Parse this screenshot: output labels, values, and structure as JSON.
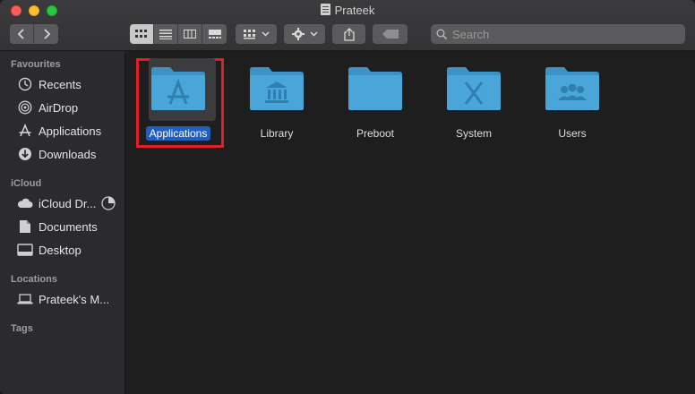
{
  "window": {
    "title": "Prateek"
  },
  "toolbar": {
    "back_icon": "chevron-left-icon",
    "forward_icon": "chevron-right-icon",
    "view_modes": [
      "icon-view",
      "list-view",
      "column-view",
      "gallery-view"
    ],
    "active_view": "icon-view",
    "search_placeholder": "Search"
  },
  "sidebar": {
    "favourites_header": "Favourites",
    "favourites": [
      {
        "label": "Recents",
        "icon": "clock-icon"
      },
      {
        "label": "AirDrop",
        "icon": "airdrop-icon"
      },
      {
        "label": "Applications",
        "icon": "applications-icon"
      },
      {
        "label": "Downloads",
        "icon": "download-icon"
      }
    ],
    "icloud_header": "iCloud",
    "icloud": [
      {
        "label": "iCloud Dr...",
        "icon": "cloud-icon"
      },
      {
        "label": "Documents",
        "icon": "document-icon"
      },
      {
        "label": "Desktop",
        "icon": "desktop-icon"
      }
    ],
    "locations_header": "Locations",
    "locations": [
      {
        "label": "Prateek's M...",
        "icon": "laptop-icon"
      }
    ],
    "tags_header": "Tags"
  },
  "content": {
    "items": [
      {
        "label": "Applications",
        "glyph": "A",
        "selected": true
      },
      {
        "label": "Library",
        "glyph": "library",
        "selected": false
      },
      {
        "label": "Preboot",
        "glyph": "",
        "selected": false
      },
      {
        "label": "System",
        "glyph": "X",
        "selected": false
      },
      {
        "label": "Users",
        "glyph": "users",
        "selected": false
      }
    ]
  },
  "colors": {
    "folder": "#4aa5d8",
    "folder_tab": "#3d92c4",
    "selection": "#1f5fbf",
    "annotation": "#e21f26"
  }
}
